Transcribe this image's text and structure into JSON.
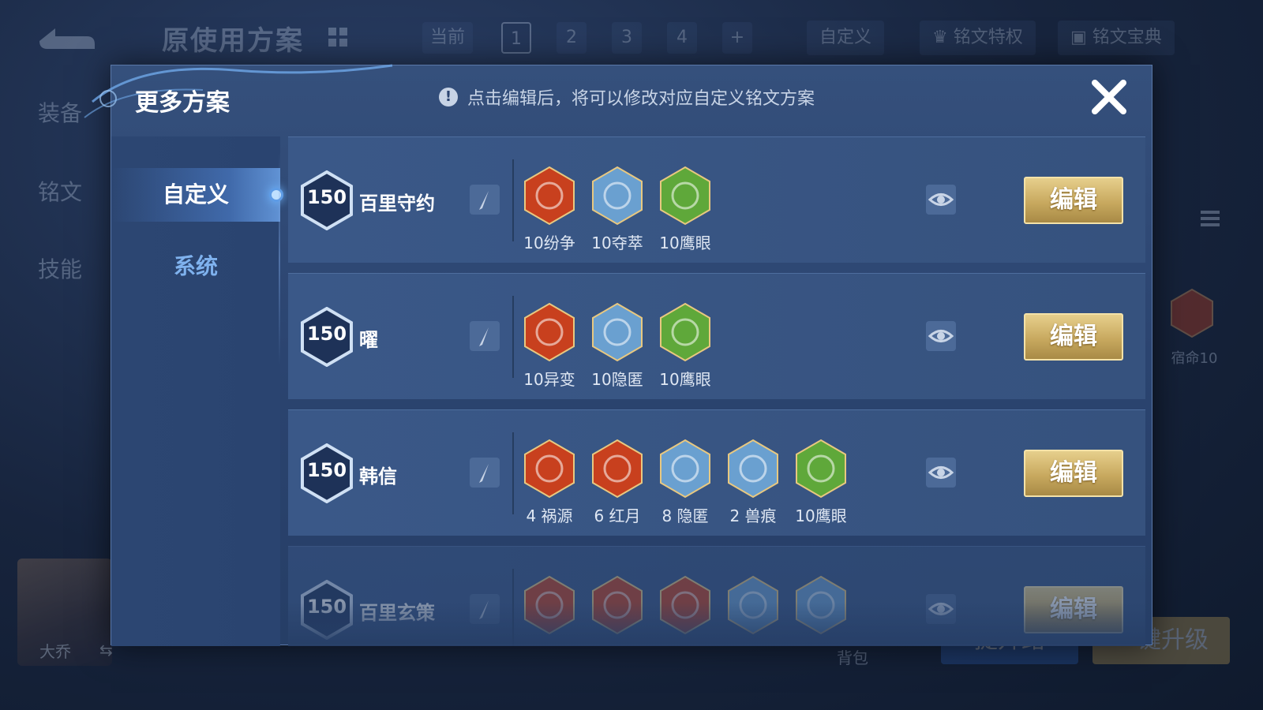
{
  "background": {
    "title": "原使用方案",
    "tabs": [
      "当前",
      "1",
      "2",
      "3",
      "4",
      "+"
    ],
    "buttons": {
      "custom": "自定义",
      "privilege": "铭文特权",
      "guide": "铭文宝典"
    },
    "left_nav": [
      "装备",
      "铭文",
      "技能"
    ],
    "right_rune_label": "宿命10",
    "hero_name": "大乔",
    "hero_swap": "⇆",
    "bottom_label": "背包",
    "bottom_buttons": [
      "提升路",
      "一键升级"
    ]
  },
  "modal": {
    "title": "更多方案",
    "hint": "点击编辑后，将可以修改对应自定义铭文方案",
    "hint_icon": "!",
    "sidebar": {
      "active_tab": "自定义",
      "inactive_tab": "系统"
    },
    "rows": [
      {
        "level": "150",
        "name": "百里守约",
        "edit_label": "编辑",
        "runes": [
          {
            "label": "10纷争",
            "color": "#c8401e"
          },
          {
            "label": "10夺萃",
            "color": "#6aa0d0"
          },
          {
            "label": "10鹰眼",
            "color": "#5fa83a"
          }
        ]
      },
      {
        "level": "150",
        "name": "曜",
        "edit_label": "编辑",
        "runes": [
          {
            "label": "10异变",
            "color": "#c8401e"
          },
          {
            "label": "10隐匿",
            "color": "#6aa0d0"
          },
          {
            "label": "10鹰眼",
            "color": "#5fa83a"
          }
        ]
      },
      {
        "level": "150",
        "name": "韩信",
        "edit_label": "编辑",
        "runes": [
          {
            "label": "4 祸源",
            "color": "#c8401e"
          },
          {
            "label": "6 红月",
            "color": "#c8401e"
          },
          {
            "label": "8 隐匿",
            "color": "#6aa0d0"
          },
          {
            "label": "2 兽痕",
            "color": "#6aa0d0"
          },
          {
            "label": "10鹰眼",
            "color": "#5fa83a"
          }
        ]
      },
      {
        "level": "150",
        "name": "百里玄策",
        "edit_label": "编辑",
        "runes": [
          {
            "label": "",
            "color": "#c8401e"
          },
          {
            "label": "",
            "color": "#c8401e"
          },
          {
            "label": "",
            "color": "#c8401e"
          },
          {
            "label": "",
            "color": "#6aa0d0"
          },
          {
            "label": "",
            "color": "#6aa0d0"
          }
        ]
      }
    ]
  }
}
